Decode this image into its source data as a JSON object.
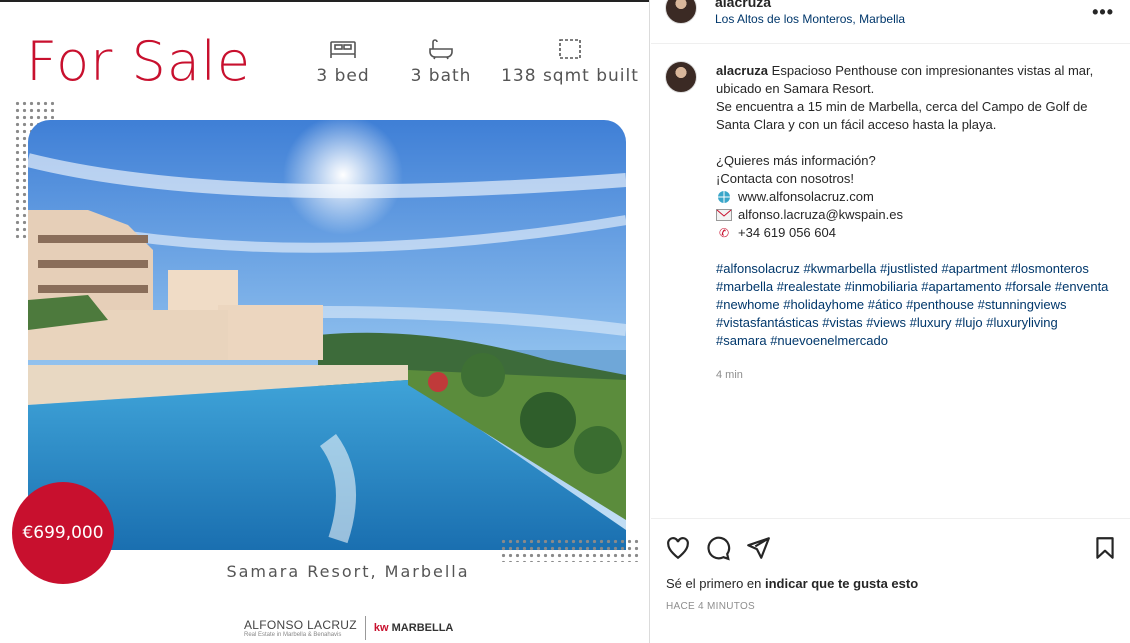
{
  "listing": {
    "headline": "For Sale",
    "beds": "3 bed",
    "baths": "3 bath",
    "area": "138 sqmt built",
    "price": "€699,000",
    "location": "Samara Resort, Marbella",
    "brand_name": "ALFONSO LACRUZ",
    "brand_sub": "Real Estate in Marbella & Benahavis",
    "brand_kw": "kw",
    "brand_kw_city": "MARBELLA"
  },
  "colors": {
    "accent": "#c8102e",
    "link": "#00376b",
    "muted": "#8e8e8e"
  },
  "header": {
    "username": "alacruza",
    "location": "Los Altos de los Monteros, Marbella",
    "more_icon": "more-horizontal-icon"
  },
  "caption": {
    "username": "alacruza",
    "line1": "Espacioso Penthouse con impresionantes vistas al mar, ubicado en Samara Resort.",
    "line2": "Se encuentra a 15 min de Marbella, cerca del Campo de Golf de Santa Clara y con un fácil acceso hasta la playa.",
    "q1": "¿Quieres más información?",
    "q2": "¡Contacta con nosotros!",
    "website": "www.alfonsolacruz.com",
    "email": "alfonso.lacruza@kwspain.es",
    "phone": "+34 619 056 604",
    "hashtags": "#alfonsolacruz #kwmarbella #justlisted #apartment #losmonteros #marbella #realestate #inmobiliaria #apartamento #forsale #enventa #newhome #holidayhome #ático #penthouse #stunningviews #vistasfantásticas #vistas #views #luxury #lujo #luxuryliving #samara #nuevoenelmercado",
    "time": "4 min"
  },
  "actions": {
    "like_icon": "heart-icon",
    "comment_icon": "comment-icon",
    "share_icon": "paper-plane-icon",
    "save_icon": "bookmark-icon",
    "likes_prefix": "Sé el primero en ",
    "likes_link": "indicar que te gusta esto",
    "post_time": "HACE 4 MINUTOS"
  }
}
